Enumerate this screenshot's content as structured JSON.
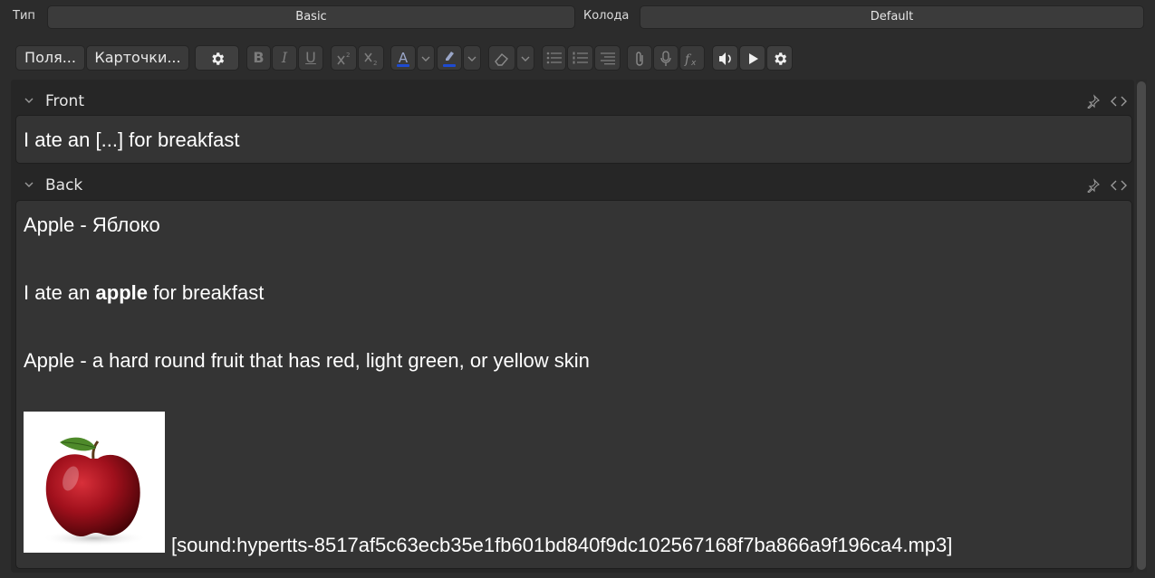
{
  "top": {
    "type_label": "Тип",
    "type_value": "Basic",
    "deck_label": "Колода",
    "deck_value": "Default"
  },
  "toolbar": {
    "fields_label": "Поля...",
    "cards_label": "Карточки...",
    "bold": "B",
    "italic": "I",
    "underline": "U",
    "font_color_letter": "A",
    "text_color": "#1e4bd2"
  },
  "fields": [
    {
      "name": "Front",
      "lines": [
        "I ate an [...] for breakfast"
      ]
    },
    {
      "name": "Back",
      "line1": "Apple - Яблоко",
      "line2_pre": "I ate an ",
      "line2_bold": "apple",
      "line2_post": " for breakfast",
      "line3": "Apple - a hard round fruit that has red, light green, or yellow skin",
      "sound": "[sound:hypertts-8517af5c63ecb35e1fb601bd840f9dc102567168f7ba866a9f196ca4.mp3]"
    }
  ]
}
